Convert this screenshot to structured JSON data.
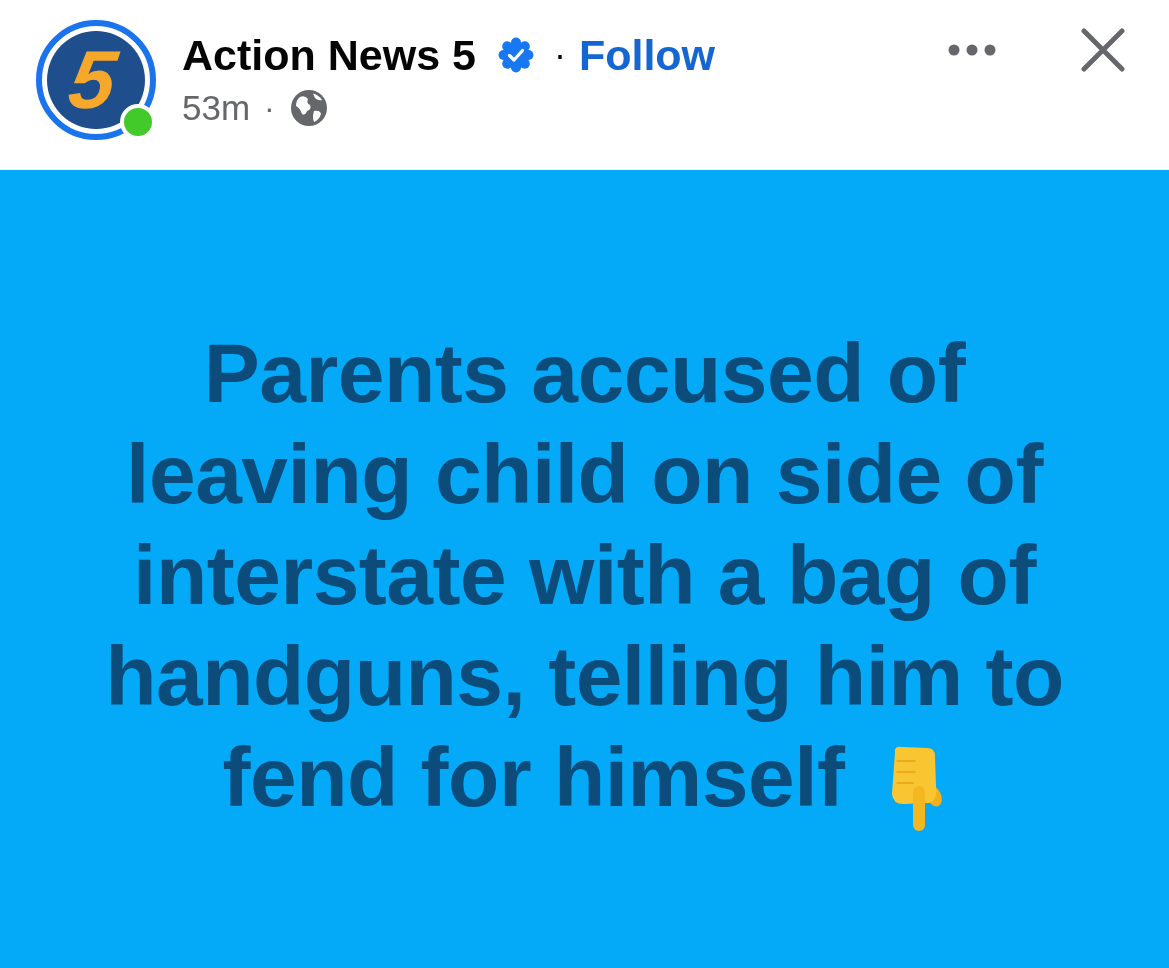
{
  "post_header": {
    "avatar": {
      "logo_text": "5",
      "online": true
    },
    "page_name": "Action News 5",
    "verified": true,
    "name_separator": "·",
    "follow_label": "Follow",
    "time": "53m",
    "meta_separator": "·"
  },
  "post": {
    "headline_lines": [
      "Parents accused of",
      "leaving child on side of",
      "interstate with a bag of",
      "handguns, telling him to",
      "fend for himself"
    ]
  }
}
